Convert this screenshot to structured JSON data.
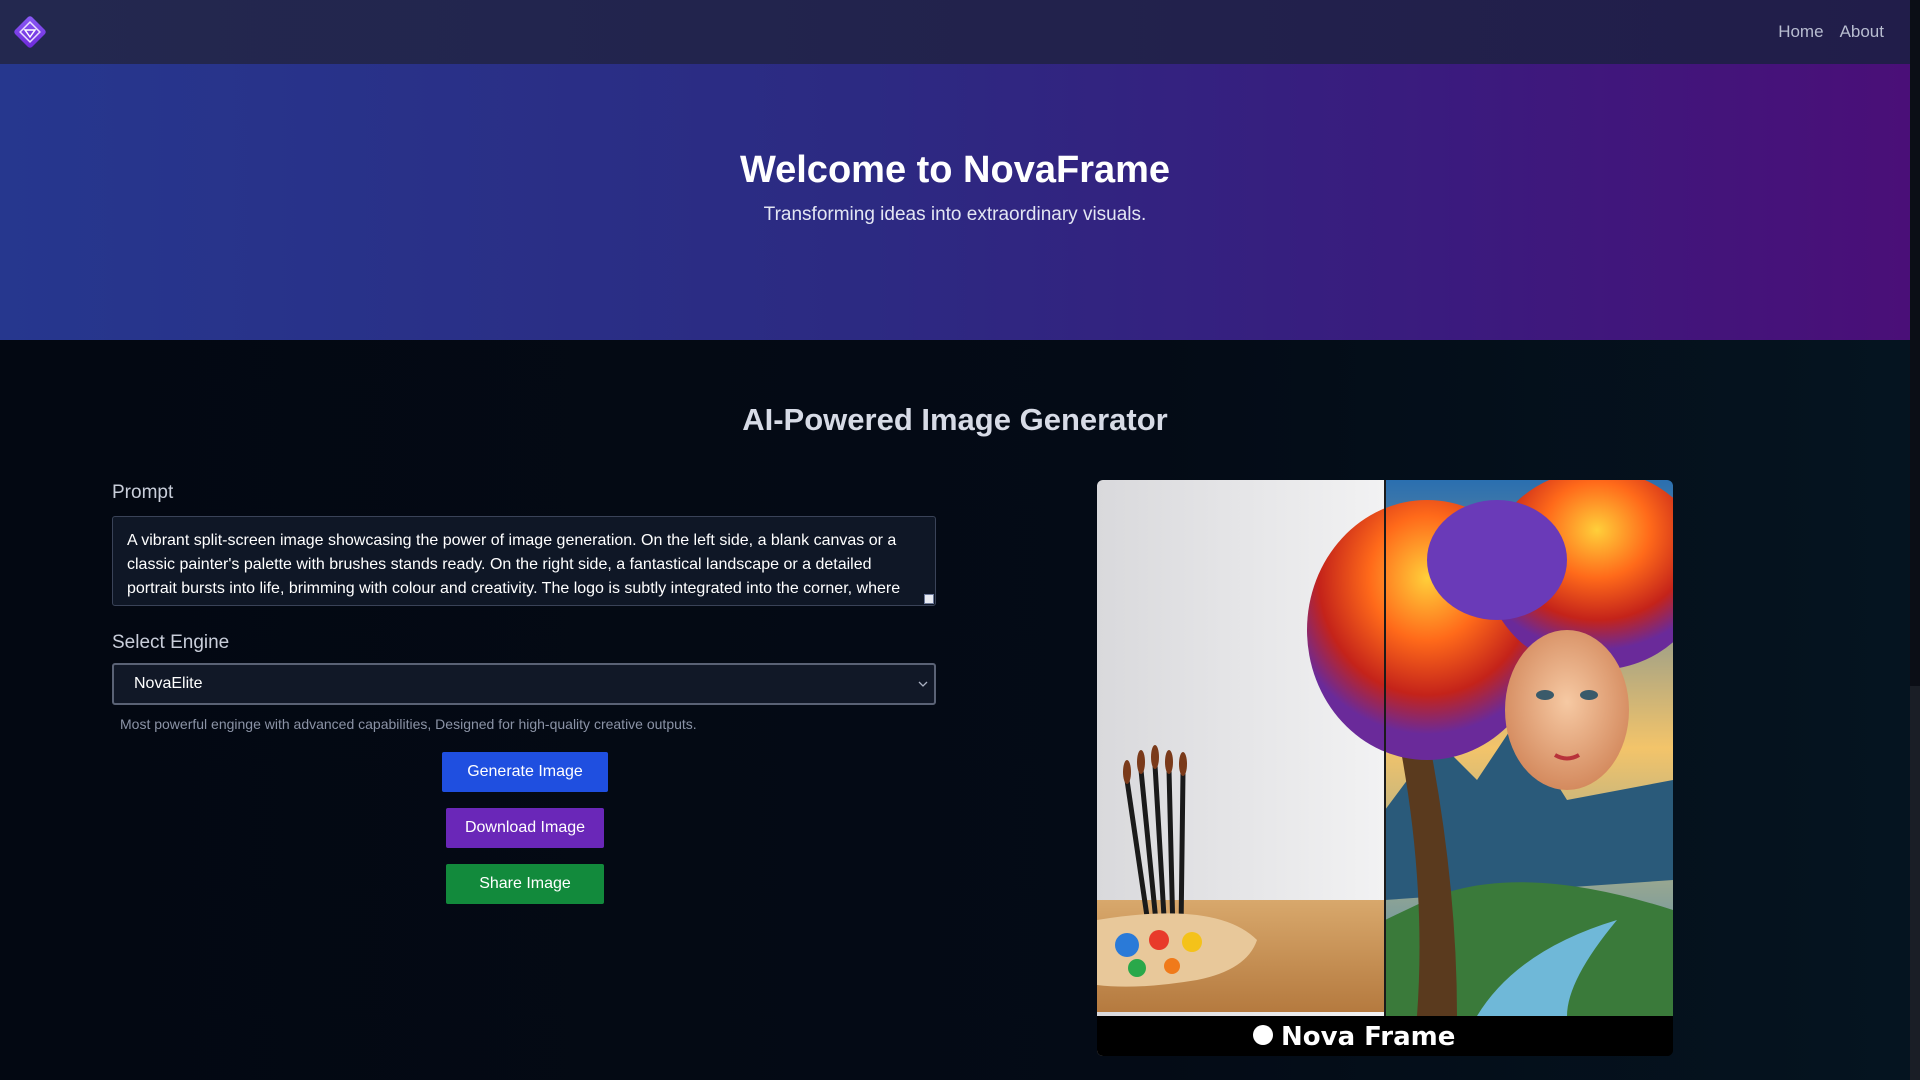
{
  "nav": {
    "logo_icon": "diamond-logo-icon",
    "links": [
      {
        "label": "Home"
      },
      {
        "label": "About"
      }
    ]
  },
  "hero": {
    "title": "Welcome to NovaFrame",
    "subtitle": "Transforming ideas into extraordinary visuals."
  },
  "main": {
    "section_title": "AI-Powered Image Generator",
    "prompt": {
      "label": "Prompt",
      "value": "A vibrant split-screen image showcasing the power of image generation. On the left side, a blank canvas or a classic painter's palette with brushes stands ready. On the right side, a fantastical landscape or a detailed portrait bursts into life, brimming with colour and creativity. The  logo is subtly integrated into the corner, where gradient overlaps at the small gradient text an broad gradient the "
    },
    "engine": {
      "label": "Select Engine",
      "selected": "NovaElite",
      "description": "Most powerful enginge with advanced capabilities, Designed for high-quality creative outputs."
    },
    "buttons": {
      "generate": "Generate Image",
      "download": "Download Image",
      "share": "Share Image"
    },
    "preview": {
      "watermark": "Nova Frame"
    }
  },
  "colors": {
    "nav_bg": "#23284f",
    "hero_gradient_start": "#26378e",
    "hero_gradient_end": "#4a0f78",
    "generate_button": "#1f4fe0",
    "download_button": "#6a27b8",
    "share_button": "#128a3c"
  }
}
